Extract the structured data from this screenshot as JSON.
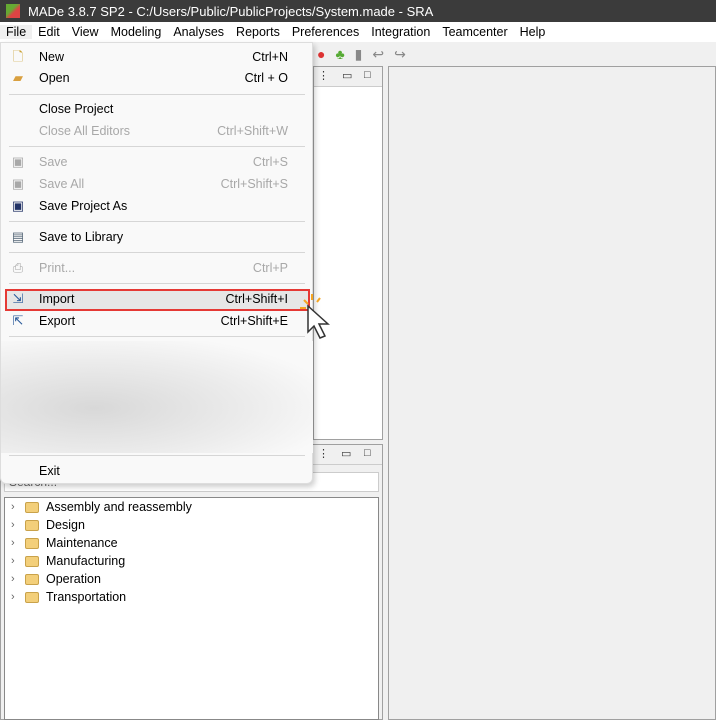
{
  "title": "MADe 3.8.7 SP2 - C:/Users/Public/PublicProjects/System.made - SRA",
  "menubar": [
    "File",
    "Edit",
    "View",
    "Modeling",
    "Analyses",
    "Reports",
    "Preferences",
    "Integration",
    "Teamcenter",
    "Help"
  ],
  "file_menu": {
    "new": {
      "label": "New",
      "shortcut": "Ctrl+N"
    },
    "open": {
      "label": "Open",
      "shortcut": "Ctrl + O"
    },
    "close_project": {
      "label": "Close Project"
    },
    "close_all": {
      "label": "Close All Editors",
      "shortcut": "Ctrl+Shift+W"
    },
    "save": {
      "label": "Save",
      "shortcut": "Ctrl+S"
    },
    "save_all": {
      "label": "Save All",
      "shortcut": "Ctrl+Shift+S"
    },
    "save_as": {
      "label": "Save Project As"
    },
    "save_lib": {
      "label": "Save to Library"
    },
    "print": {
      "label": "Print...",
      "shortcut": "Ctrl+P"
    },
    "import": {
      "label": "Import",
      "shortcut": "Ctrl+Shift+I"
    },
    "export": {
      "label": "Export",
      "shortcut": "Ctrl+Shift+E"
    },
    "exit": {
      "label": "Exit"
    }
  },
  "search": {
    "placeholder": "Search..."
  },
  "tree": [
    "Assembly and reassembly",
    "Design",
    "Maintenance",
    "Manufacturing",
    "Operation",
    "Transportation"
  ],
  "colors": {
    "highlight_border": "#e53935",
    "titlebar": "#3b3b3b"
  }
}
